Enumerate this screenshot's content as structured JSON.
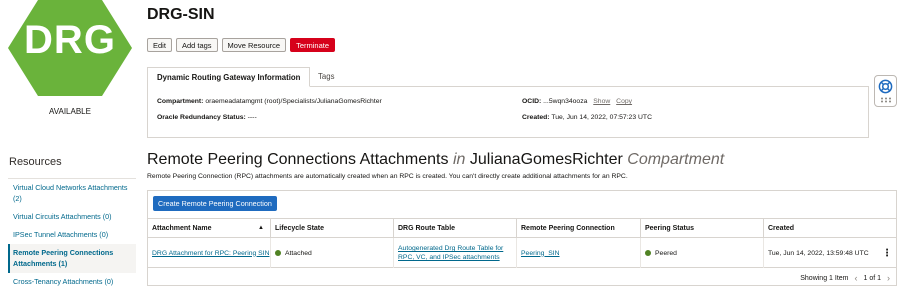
{
  "resource": {
    "badge_text": "DRG",
    "badge_color": "#6ab33b",
    "status": "AVAILABLE",
    "title": "DRG-SIN"
  },
  "actions": {
    "edit": "Edit",
    "add_tags": "Add tags",
    "move": "Move Resource",
    "terminate": "Terminate"
  },
  "info_tabs": {
    "info": "Dynamic Routing Gateway Information",
    "tags": "Tags"
  },
  "info": {
    "compartment_label": "Compartment:",
    "compartment_value": "oraemeadatamgmt (root)/Specialists/JulianaGomesRichter",
    "redundancy_label": "Oracle Redundancy Status:",
    "redundancy_value": "----",
    "ocid_label": "OCID:",
    "ocid_value": "...5wqn34ooza",
    "show": "Show",
    "copy": "Copy",
    "created_label": "Created:",
    "created_value": "Tue, Jun 14, 2022, 07:57:23 UTC"
  },
  "sidebar": {
    "title": "Resources",
    "items": [
      {
        "label": "Virtual Cloud Networks Attachments (2)"
      },
      {
        "label": "Virtual Circuits Attachments (0)"
      },
      {
        "label": "IPSec Tunnel Attachments (0)"
      },
      {
        "label": "Remote Peering Connections Attachments (1)"
      },
      {
        "label": "Cross-Tenancy Attachments (0)"
      }
    ]
  },
  "section": {
    "title_main": "Remote Peering Connections Attachments",
    "title_in": "in",
    "title_compartment": "JulianaGomesRichter",
    "title_suffix": "Compartment",
    "description": "Remote Peering Connection (RPC) attachments are automatically created when an RPC is created. You can't directly create additional attachments for an RPC.",
    "create_button": "Create Remote Peering Connection"
  },
  "table": {
    "columns": [
      "Attachment Name",
      "Lifecycle State",
      "DRG Route Table",
      "Remote Peering Connection",
      "Peering Status",
      "Created"
    ],
    "rows": [
      {
        "name": "DRG Attachment for RPC: Peering SIN",
        "state": "Attached",
        "route_table": "Autogenerated Drg Route Table for RPC, VC, and IPSec attachments",
        "rpc": "Peering_SIN",
        "peering_status": "Peered",
        "created": "Tue, Jun 14, 2022, 13:59:48 UTC"
      }
    ],
    "showing": "Showing 1 Item",
    "page": "1 of 1"
  },
  "colors": {
    "accent": "#1f6bbf",
    "link": "#00688c",
    "danger": "#d6011b",
    "status_green": "#508223"
  }
}
